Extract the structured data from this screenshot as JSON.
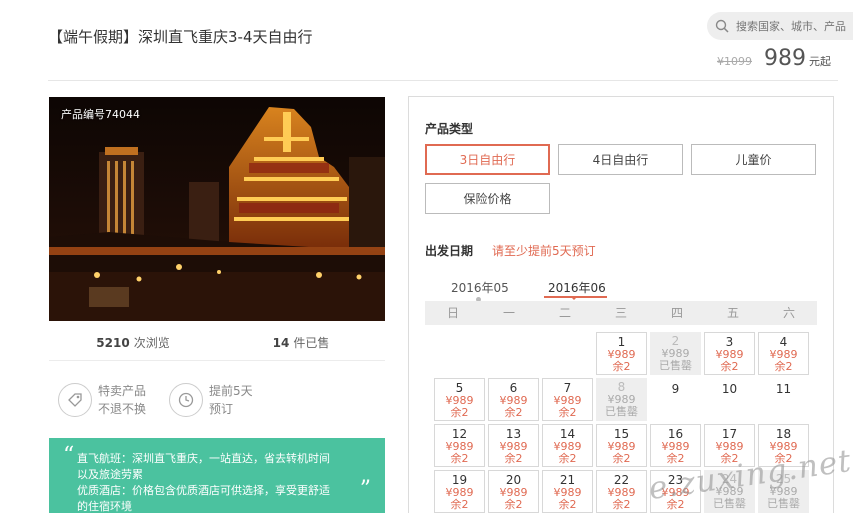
{
  "header": {
    "title": "【端午假期】深圳直飞重庆3-4天自由行",
    "search_placeholder": "搜索国家、城市、产品",
    "old_price": "¥1099",
    "price": "989",
    "price_suffix": "元起"
  },
  "product": {
    "code_label": "产品编号74044",
    "views_count": "5210",
    "views_label": "次浏览",
    "sold_count": "14",
    "sold_label": "件已售"
  },
  "features": [
    {
      "icon": "tag-icon",
      "line1": "特卖产品",
      "line2": "不退不换"
    },
    {
      "icon": "clock-icon",
      "line1": "提前5天",
      "line2": "预订"
    }
  ],
  "highlights": {
    "line1": "直飞航班：深圳直飞重庆，一站直达，省去转机时间",
    "line2": "以及旅途劳累",
    "line3": "优质酒店：价格包含优质酒店可供选择，享受更舒适",
    "line4": "的住宿环境"
  },
  "booking": {
    "type_label": "产品类型",
    "types": [
      "3日自由行",
      "4日自由行",
      "儿童价",
      "保险价格"
    ],
    "active_type": "3日自由行",
    "date_label": "出发日期",
    "hint": "请至少提前5天预订",
    "months": [
      "2016年05",
      "2016年06"
    ],
    "active_month": "2016年06",
    "weekdays": [
      "日",
      "一",
      "二",
      "三",
      "四",
      "五",
      "六"
    ],
    "price_text": "¥989",
    "remain_text": "余2",
    "sold_text": "已售罄"
  },
  "calendar": [
    {
      "day": "1",
      "status": "avail",
      "col": 3,
      "row": 0
    },
    {
      "day": "2",
      "status": "sold",
      "col": 4,
      "row": 0
    },
    {
      "day": "3",
      "status": "avail",
      "col": 5,
      "row": 0
    },
    {
      "day": "4",
      "status": "avail",
      "col": 6,
      "row": 0
    },
    {
      "day": "5",
      "status": "avail",
      "col": 0,
      "row": 1
    },
    {
      "day": "6",
      "status": "avail",
      "col": 1,
      "row": 1
    },
    {
      "day": "7",
      "status": "avail",
      "col": 2,
      "row": 1
    },
    {
      "day": "8",
      "status": "sold",
      "col": 3,
      "row": 1
    },
    {
      "day": "9",
      "status": "empty",
      "col": 4,
      "row": 1
    },
    {
      "day": "10",
      "status": "empty",
      "col": 5,
      "row": 1
    },
    {
      "day": "11",
      "status": "empty",
      "col": 6,
      "row": 1
    },
    {
      "day": "12",
      "status": "avail",
      "col": 0,
      "row": 2
    },
    {
      "day": "13",
      "status": "avail",
      "col": 1,
      "row": 2
    },
    {
      "day": "14",
      "status": "avail",
      "col": 2,
      "row": 2
    },
    {
      "day": "15",
      "status": "avail",
      "col": 3,
      "row": 2
    },
    {
      "day": "16",
      "status": "avail",
      "col": 4,
      "row": 2
    },
    {
      "day": "17",
      "status": "avail",
      "col": 5,
      "row": 2
    },
    {
      "day": "18",
      "status": "avail",
      "col": 6,
      "row": 2
    },
    {
      "day": "19",
      "status": "avail",
      "col": 0,
      "row": 3
    },
    {
      "day": "20",
      "status": "avail",
      "col": 1,
      "row": 3
    },
    {
      "day": "21",
      "status": "avail",
      "col": 2,
      "row": 3
    },
    {
      "day": "22",
      "status": "avail",
      "col": 3,
      "row": 3
    },
    {
      "day": "23",
      "status": "avail",
      "col": 4,
      "row": 3
    },
    {
      "day": "24",
      "status": "sold",
      "col": 5,
      "row": 3
    },
    {
      "day": "25",
      "status": "sold",
      "col": 6,
      "row": 3
    }
  ],
  "watermark": "e.zuxing.net",
  "colors": {
    "accent": "#e06a52",
    "green": "#4bc29f"
  }
}
